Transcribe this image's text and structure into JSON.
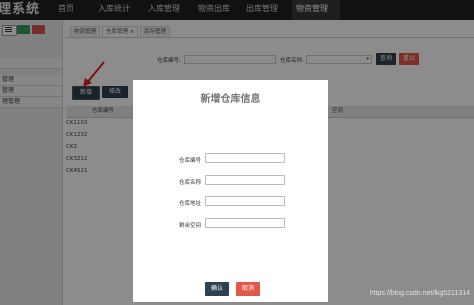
{
  "app": {
    "title": "理系统"
  },
  "nav": [
    "首页",
    "入库统计",
    "入库管理",
    "物资出库",
    "出库管理",
    "物资管理"
  ],
  "breadcrumb_tabs": [
    "物资管理",
    "仓库管理 ×",
    "库存管理"
  ],
  "sidebar": {
    "items": [
      "",
      "管理",
      "管理",
      "理管理"
    ]
  },
  "search": {
    "code_label": "仓库编号:",
    "name_label": "仓库名称:",
    "query_btn": "查询",
    "reset_btn": "重公"
  },
  "toolbar": {
    "add_btn": "新增",
    "edit_btn": "修改"
  },
  "table": {
    "headers": [
      "仓库编号",
      "空间"
    ],
    "rows": [
      "CK1102",
      "CK1232",
      "CK2",
      "CK3212",
      "CK4521"
    ]
  },
  "modal": {
    "title": "新增仓库信息",
    "fields": [
      {
        "label": "仓库编号",
        "value": ""
      },
      {
        "label": "仓库名称",
        "value": ""
      },
      {
        "label": "仓库地址",
        "value": ""
      },
      {
        "label": "剩余空间",
        "value": ""
      }
    ],
    "confirm": "确认",
    "cancel": "取消"
  },
  "watermark": "https://blog.csdn.net/lkg5211314",
  "colors": {
    "topbar": "#1f1f1f",
    "primary_btn": "#2f4050",
    "danger_btn": "#e4584a",
    "green_btn": "#2e9e5b"
  }
}
